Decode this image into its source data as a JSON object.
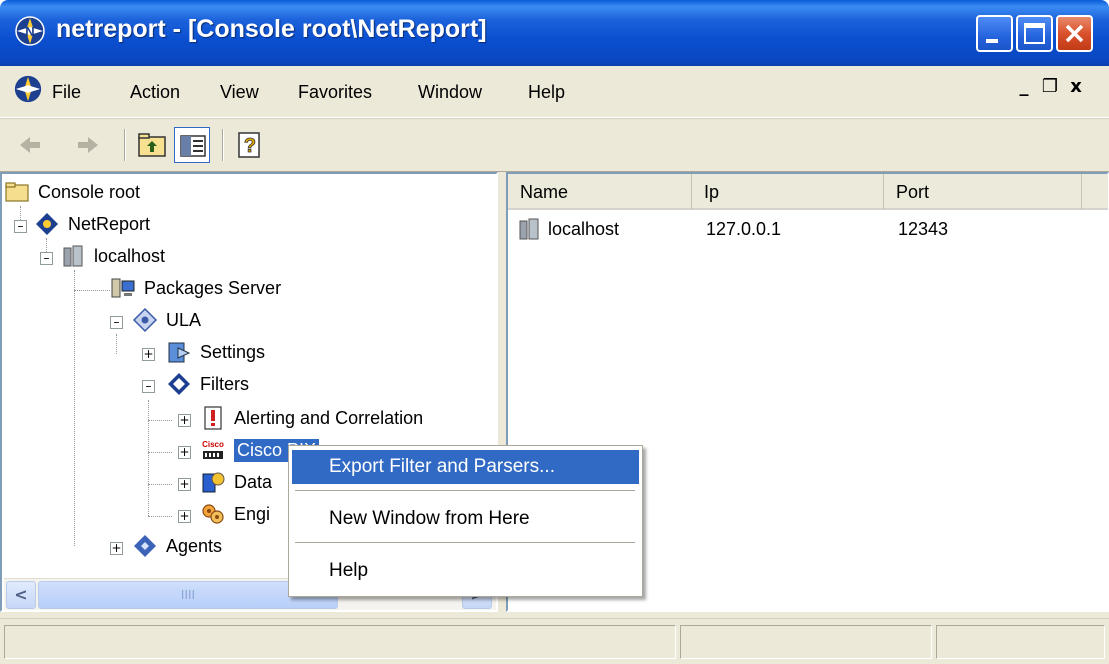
{
  "window": {
    "title": "netreport - [Console root\\NetReport]"
  },
  "menubar": {
    "items": [
      "File",
      "Action",
      "View",
      "Favorites",
      "Window",
      "Help"
    ],
    "mdi_min": "_",
    "mdi_restore": "❐",
    "mdi_close": "x"
  },
  "toolbar": {
    "icons": [
      "back-arrow-icon",
      "forward-arrow-icon",
      "up-folder-icon",
      "show-hide-tree-icon",
      "help-icon"
    ]
  },
  "tree": {
    "items": [
      {
        "label": "Console root",
        "icon": "folder-icon"
      },
      {
        "label": "NetReport",
        "icon": "netreport-icon"
      },
      {
        "label": "localhost",
        "icon": "server-icon"
      },
      {
        "label": "Packages Server",
        "icon": "computer-icon"
      },
      {
        "label": "ULA",
        "icon": "ula-icon"
      },
      {
        "label": "Settings",
        "icon": "settings-icon"
      },
      {
        "label": "Filters",
        "icon": "filters-icon"
      },
      {
        "label": "Alerting and Correlation",
        "icon": "alert-icon"
      },
      {
        "label": "Cisco PIX",
        "icon": "cisco-icon"
      },
      {
        "label": "Data",
        "icon": "database-icon"
      },
      {
        "label": "Engi",
        "icon": "engine-icon"
      },
      {
        "label": "Agents",
        "icon": "agents-icon"
      }
    ]
  },
  "list": {
    "columns": [
      "Name",
      "Ip",
      "Port"
    ],
    "rows": [
      {
        "name": "localhost",
        "ip": "127.0.0.1",
        "port": "12343"
      }
    ]
  },
  "scrollbar": {
    "left_arrow": "<",
    "right_arrow": ">",
    "grip": "IIII"
  },
  "context_menu": {
    "items": [
      "Export Filter and Parsers...",
      "New Window from Here",
      "Help"
    ]
  },
  "colors": {
    "titlebar": "#0a4fd0",
    "selection": "#316ac5",
    "chrome": "#ece9d8"
  }
}
